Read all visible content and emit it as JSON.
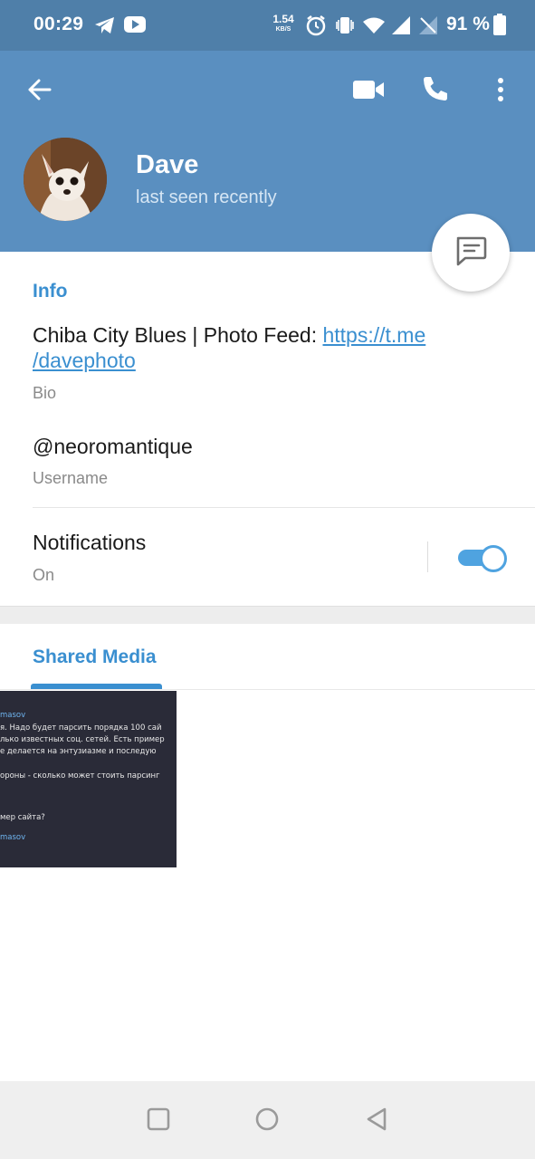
{
  "status_bar": {
    "time": "00:29",
    "net_speed_value": "1.54",
    "net_speed_unit": "KB/S",
    "battery": "91 %"
  },
  "profile": {
    "name": "Dave",
    "status": "last seen recently"
  },
  "info": {
    "section_title": "Info",
    "bio_text": "Chiba City Blues | Photo Feed: ",
    "bio_link": "https://t.me/davephoto",
    "bio_link_line1": "https://t.me",
    "bio_link_line2": "/davephoto",
    "bio_label": "Bio",
    "username": "@neoromantique",
    "username_label": "Username",
    "notifications_label": "Notifications",
    "notifications_value": "On",
    "notifications_enabled": true
  },
  "shared_media": {
    "tab_label": "Shared Media",
    "thumbnail_lines": [
      "masov",
      "я. Надо будет парсить порядка 100 сай",
      "лько известных соц. сетей. Есть пример",
      "е делается на энтузиазме и последую",
      "ороны - сколько может стоить парсинг",
      "мер сайта?",
      "masov"
    ]
  },
  "colors": {
    "status_bar_bg": "#4f7fa9",
    "header_bg": "#5a8fc0",
    "accent": "#3a8fd0",
    "toggle_on": "#4fa3e0"
  },
  "icons": {
    "back": "arrow-left-icon",
    "video_call": "video-camera-icon",
    "call": "phone-icon",
    "menu": "more-vertical-icon",
    "message": "chat-bubble-icon"
  }
}
